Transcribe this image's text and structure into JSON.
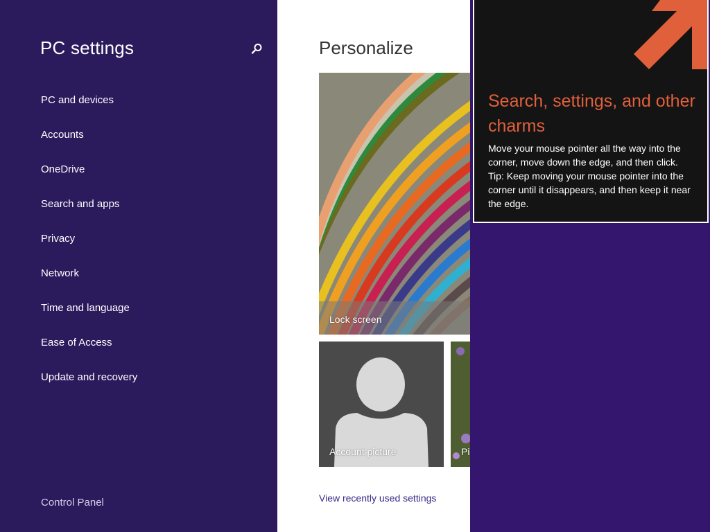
{
  "sidebar": {
    "title": "PC settings",
    "search_icon": "search-icon",
    "items": [
      {
        "label": "PC and devices"
      },
      {
        "label": "Accounts"
      },
      {
        "label": "OneDrive"
      },
      {
        "label": "Search and apps"
      },
      {
        "label": "Privacy"
      },
      {
        "label": "Network"
      },
      {
        "label": "Time and language"
      },
      {
        "label": "Ease of Access"
      },
      {
        "label": "Update and recovery"
      }
    ],
    "footer_link": "Control Panel"
  },
  "main": {
    "title": "Personalize",
    "tiles": {
      "lock_screen": "Lock screen",
      "account_picture": "Account picture",
      "picture_partial": "Pi"
    },
    "recent_link": "View recently used settings"
  },
  "charm_tip": {
    "heading": "Search, settings, and other charms",
    "body": "Move your mouse pointer all the way into the corner, move down the edge, and then click. Tip: Keep moving your mouse pointer into the corner until it disappears, and then keep it near the edge."
  },
  "colors": {
    "sidebar_bg": "#2b1a5c",
    "accent_orange": "#e0603b",
    "charm_bg": "#141414",
    "link": "#3a2a8a"
  }
}
